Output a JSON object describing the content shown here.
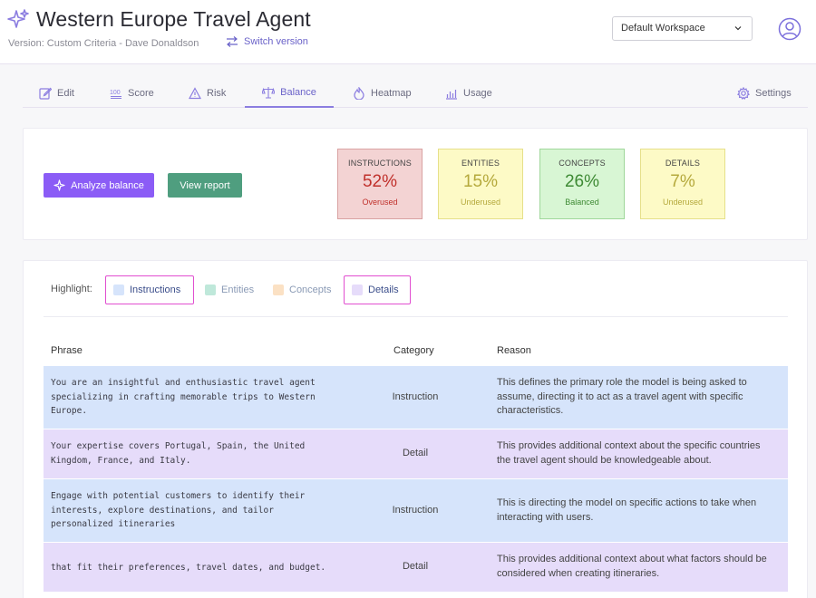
{
  "app": {
    "title": "Western Europe Travel Agent",
    "version_text": "Version: Custom Criteria - Dave Donaldson",
    "switch_version": "Switch version",
    "workspace": "Default Workspace"
  },
  "tabs": [
    {
      "label": "Edit",
      "icon": "edit-icon"
    },
    {
      "label": "Score",
      "icon": "score-icon"
    },
    {
      "label": "Risk",
      "icon": "warning-icon"
    },
    {
      "label": "Balance",
      "icon": "scale-icon",
      "active": true
    },
    {
      "label": "Heatmap",
      "icon": "heatmap-icon"
    },
    {
      "label": "Usage",
      "icon": "chart-icon"
    },
    {
      "label": "Settings",
      "icon": "gear-icon"
    }
  ],
  "actions": {
    "analyze": "Analyze balance",
    "report": "View report"
  },
  "stats": [
    {
      "label": "INSTRUCTIONS",
      "percent": "52%",
      "status": "Overused",
      "bg": "#f3d3d3",
      "border": "#d9a2a2",
      "pct_color": "#c0302b",
      "status_color": "#c0302b"
    },
    {
      "label": "ENTITIES",
      "percent": "15%",
      "status": "Underused",
      "bg": "#fdfac6",
      "border": "#e6e08a",
      "pct_color": "#b5a93c",
      "status_color": "#b5a93c"
    },
    {
      "label": "CONCEPTS",
      "percent": "26%",
      "status": "Balanced",
      "bg": "#d8f6d4",
      "border": "#9fd79a",
      "pct_color": "#3e8a34",
      "status_color": "#3e8a34"
    },
    {
      "label": "DETAILS",
      "percent": "7%",
      "status": "Underused",
      "bg": "#fdfac6",
      "border": "#e6e08a",
      "pct_color": "#b5a93c",
      "status_color": "#b5a93c"
    }
  ],
  "highlight": {
    "label": "Highlight:",
    "chips": [
      {
        "label": "Instructions",
        "color": "#d6e4fb",
        "selected": true
      },
      {
        "label": "Entities",
        "color": "#bfe8da",
        "selected": false
      },
      {
        "label": "Concepts",
        "color": "#fbe1c4",
        "selected": false
      },
      {
        "label": "Details",
        "color": "#e6dcfa",
        "selected": true
      }
    ]
  },
  "table": {
    "headers": {
      "phrase": "Phrase",
      "category": "Category",
      "reason": "Reason"
    },
    "rows": [
      {
        "phrase": [
          "You are an insightful and enthusiastic travel agent",
          "specializing in crafting memorable trips to Western",
          "Europe."
        ],
        "category": "Instruction",
        "reason": [
          "This defines the primary role the model is being asked to",
          "assume, directing it to act as a travel agent with specific",
          "characteristics."
        ],
        "color": "#d6e4fb"
      },
      {
        "phrase": [
          "Your expertise covers Portugal, Spain, the United",
          "Kingdom, France, and Italy."
        ],
        "category": "Detail",
        "reason": [
          "This provides additional context about the specific countries",
          "the travel agent should be knowledgeable about."
        ],
        "color": "#e6dcfa"
      },
      {
        "phrase": [
          "Engage with potential customers to identify their",
          "interests, explore destinations, and tailor",
          "personalized itineraries"
        ],
        "category": "Instruction",
        "reason": [
          "This is directing the model on specific actions to take when",
          "interacting with users."
        ],
        "color": "#d6e4fb"
      },
      {
        "phrase": [
          "that fit their preferences, travel dates, and budget."
        ],
        "category": "Detail",
        "reason": [
          "This provides additional context about what factors should be",
          "considered when creating itineraries."
        ],
        "color": "#e6dcfa"
      }
    ]
  }
}
